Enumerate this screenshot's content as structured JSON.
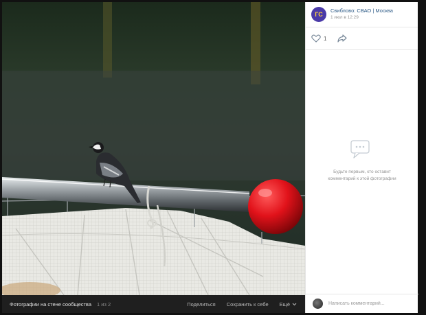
{
  "post": {
    "author": "Свиблово: СВАО | Москва",
    "avatar_text": "ГС",
    "date": "1 июл в 12:29",
    "likes": "1"
  },
  "comments": {
    "empty_text": "Будьте первым, кто оставит комментарий к этой фотографии",
    "placeholder": "Написать комментарий..."
  },
  "bottom_bar": {
    "album": "Фотографии на стене сообщества",
    "counter": "1 из 2",
    "share": "Поделиться",
    "save": "Сохранить к себе",
    "more": "Ещё"
  },
  "colors": {
    "accent": "#2a5885",
    "avatar_bg": "#4a3aa8",
    "avatar_text": "#ffd23c"
  }
}
